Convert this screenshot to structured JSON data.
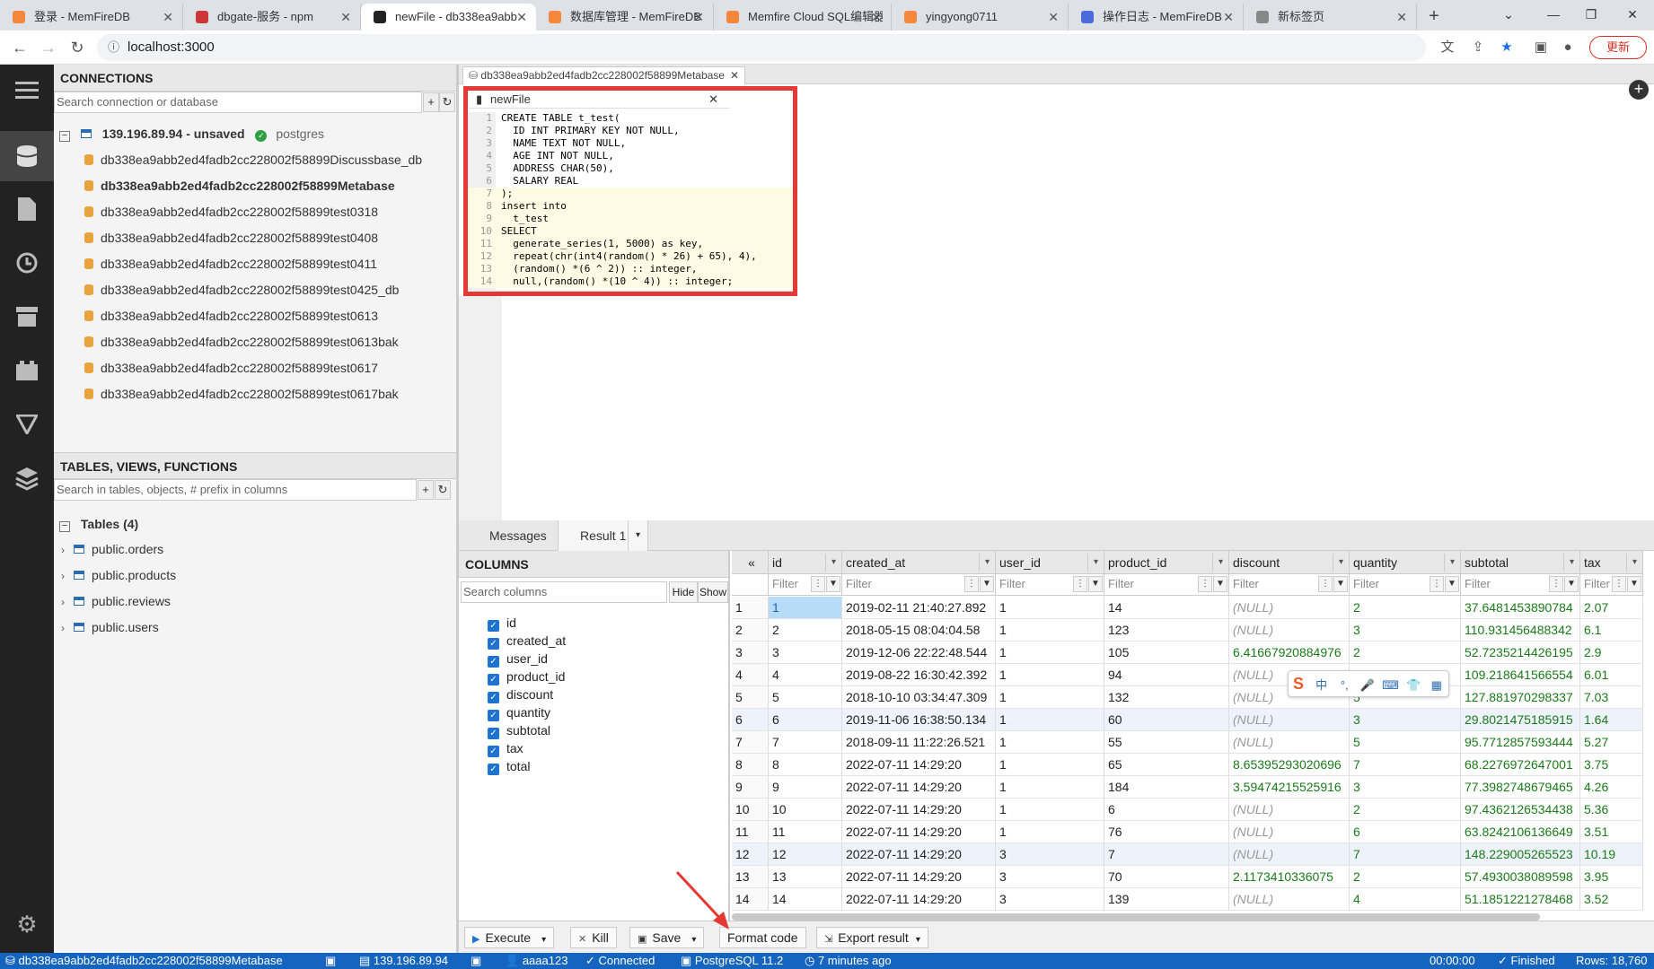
{
  "browser": {
    "tabs": [
      {
        "title": "登录 - MemFireDB",
        "color": "#f5873a",
        "active": false
      },
      {
        "title": "dbgate-服务 - npm",
        "color": "#cb3837",
        "active": false
      },
      {
        "title": "newFile - db338ea9abb",
        "color": "#222222",
        "active": true
      },
      {
        "title": "数据库管理 - MemFireDB",
        "color": "#f5873a",
        "active": false
      },
      {
        "title": "Memfire Cloud SQL编辑器",
        "color": "#f5873a",
        "active": false
      },
      {
        "title": "yingyong0711",
        "color": "#f5873a",
        "active": false
      },
      {
        "title": "操作日志 - MemFireDB",
        "color": "#4a6bdc",
        "active": false
      },
      {
        "title": "新标签页",
        "color": "#888888",
        "active": false
      }
    ],
    "url": "localhost:3000",
    "update_label": "更新"
  },
  "connections": {
    "header": "CONNECTIONS",
    "search_placeholder": "Search connection or database",
    "server": {
      "name": "139.196.89.94 - unsaved",
      "driver": "postgres"
    },
    "databases": [
      {
        "name": "db338ea9abb2ed4fadb2cc228002f58899Discussbase_db",
        "bold": false
      },
      {
        "name": "db338ea9abb2ed4fadb2cc228002f58899Metabase",
        "bold": true
      },
      {
        "name": "db338ea9abb2ed4fadb2cc228002f58899test0318",
        "bold": false
      },
      {
        "name": "db338ea9abb2ed4fadb2cc228002f58899test0408",
        "bold": false
      },
      {
        "name": "db338ea9abb2ed4fadb2cc228002f58899test0411",
        "bold": false
      },
      {
        "name": "db338ea9abb2ed4fadb2cc228002f58899test0425_db",
        "bold": false
      },
      {
        "name": "db338ea9abb2ed4fadb2cc228002f58899test0613",
        "bold": false
      },
      {
        "name": "db338ea9abb2ed4fadb2cc228002f58899test0613bak",
        "bold": false
      },
      {
        "name": "db338ea9abb2ed4fadb2cc228002f58899test0617",
        "bold": false
      },
      {
        "name": "db338ea9abb2ed4fadb2cc228002f58899test0617bak",
        "bold": false
      }
    ]
  },
  "objects": {
    "header": "TABLES, VIEWS, FUNCTIONS",
    "search_placeholder": "Search in tables, objects, # prefix in columns",
    "group_label": "Tables (4)",
    "tables": [
      "public.orders",
      "public.products",
      "public.reviews",
      "public.users"
    ]
  },
  "editor": {
    "db_tab": "db338ea9abb2ed4fadb2cc228002f58899Metabase",
    "file_tab": "newFile",
    "lines": [
      "CREATE TABLE t_test(",
      "  ID INT PRIMARY KEY NOT NULL,",
      "  NAME TEXT NOT NULL,",
      "  AGE INT NOT NULL,",
      "  ADDRESS CHAR(50),",
      "  SALARY REAL",
      ");",
      "insert into",
      "  t_test",
      "SELECT",
      "  generate_series(1, 5000) as key,",
      "  repeat(chr(int4(random() * 26) + 65), 4),",
      "  (random() *(6 ^ 2)) :: integer,",
      "  null,(random() *(10 ^ 4)) :: integer;"
    ]
  },
  "results": {
    "tabs": [
      "Messages",
      "Result 1"
    ],
    "columns_header": "COLUMNS",
    "columns_search_placeholder": "Search columns",
    "hide_label": "Hide",
    "show_label": "Show",
    "column_list": [
      "id",
      "created_at",
      "user_id",
      "product_id",
      "discount",
      "quantity",
      "subtotal",
      "tax",
      "total"
    ],
    "grid_headers": [
      "id",
      "created_at",
      "user_id",
      "product_id",
      "discount",
      "quantity",
      "subtotal",
      "tax"
    ],
    "filter_placeholder": "Filter",
    "rows": [
      [
        "1",
        "1",
        "2019-02-11 21:40:27.892",
        "1",
        "14",
        "(NULL)",
        "2",
        "37.6481453890784",
        "2.07"
      ],
      [
        "2",
        "2",
        "2018-05-15 08:04:04.58",
        "1",
        "123",
        "(NULL)",
        "3",
        "110.931456488342",
        "6.1"
      ],
      [
        "3",
        "3",
        "2019-12-06 22:22:48.544",
        "1",
        "105",
        "6.41667920884976",
        "2",
        "52.7235214426195",
        "2.9"
      ],
      [
        "4",
        "4",
        "2019-08-22 16:30:42.392",
        "1",
        "94",
        "(NULL)",
        "6",
        "109.218641566554",
        "6.01"
      ],
      [
        "5",
        "5",
        "2018-10-10 03:34:47.309",
        "1",
        "132",
        "(NULL)",
        "5",
        "127.881970298337",
        "7.03"
      ],
      [
        "6",
        "6",
        "2019-11-06 16:38:50.134",
        "1",
        "60",
        "(NULL)",
        "3",
        "29.8021475185915",
        "1.64"
      ],
      [
        "7",
        "7",
        "2018-09-11 11:22:26.521",
        "1",
        "55",
        "(NULL)",
        "5",
        "95.7712857593444",
        "5.27"
      ],
      [
        "8",
        "8",
        "2022-07-11 14:29:20",
        "1",
        "65",
        "8.65395293020696",
        "7",
        "68.2276972647001",
        "3.75"
      ],
      [
        "9",
        "9",
        "2022-07-11 14:29:20",
        "1",
        "184",
        "3.59474215525916",
        "3",
        "77.3982748679465",
        "4.26"
      ],
      [
        "10",
        "10",
        "2022-07-11 14:29:20",
        "1",
        "6",
        "(NULL)",
        "2",
        "97.4362126534438",
        "5.36"
      ],
      [
        "11",
        "11",
        "2022-07-11 14:29:20",
        "1",
        "76",
        "(NULL)",
        "6",
        "63.8242106136649",
        "3.51"
      ],
      [
        "12",
        "12",
        "2022-07-11 14:29:20",
        "3",
        "7",
        "(NULL)",
        "7",
        "148.229005265523",
        "10.19"
      ],
      [
        "13",
        "13",
        "2022-07-11 14:29:20",
        "3",
        "70",
        "2.1173410336075",
        "2",
        "57.4930038089598",
        "3.95"
      ],
      [
        "14",
        "14",
        "2022-07-11 14:29:20",
        "3",
        "139",
        "(NULL)",
        "4",
        "51.1851221278468",
        "3.52"
      ]
    ]
  },
  "toolbar": {
    "execute": "Execute",
    "kill": "Kill",
    "save": "Save",
    "format": "Format code",
    "export": "Export result"
  },
  "ime": [
    "中",
    "°,",
    "🎤",
    "⌨",
    "👕",
    "▦"
  ],
  "status": {
    "database": "db338ea9abb2ed4fadb2cc228002f58899Metabase",
    "server": "139.196.89.94",
    "user": "aaaa123",
    "connection": "Connected",
    "engine": "PostgreSQL 11.2",
    "ago": "7 minutes ago",
    "elapsed": "00:00:00",
    "state": "Finished",
    "rows": "Rows: 18,760"
  },
  "colors": {
    "accent": "#1565c0",
    "highlight_box": "#e53935",
    "sidebar": "#222222"
  }
}
